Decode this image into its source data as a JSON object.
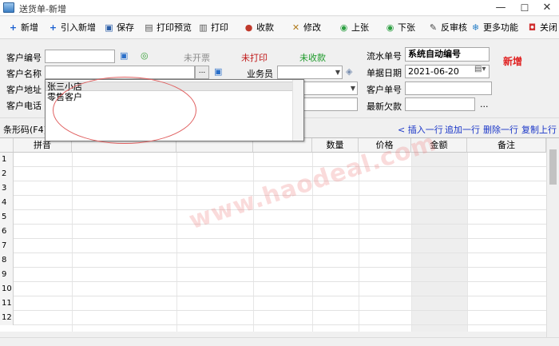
{
  "window": {
    "title": "送货单-新增",
    "min": "—",
    "max": "☐",
    "close": "✕"
  },
  "toolbar": [
    {
      "label": "新增",
      "icon": "+",
      "color": "#1a5fd0"
    },
    {
      "label": "引入新增",
      "icon": "+",
      "color": "#1a5fd0"
    },
    {
      "label": "保存",
      "icon": "▣",
      "color": "#2b5ea8"
    },
    {
      "label": "打印预览",
      "icon": "▤",
      "color": "#555555"
    },
    {
      "label": "打印",
      "icon": "▥",
      "color": "#555555"
    },
    {
      "label": "收款",
      "icon": "●",
      "color": "#c0392b"
    },
    {
      "label": "修改",
      "icon": "✕",
      "color": "#b07a1a"
    },
    {
      "label": "上张",
      "icon": "◉",
      "color": "#2ea043"
    },
    {
      "label": "下张",
      "icon": "◉",
      "color": "#2ea043"
    },
    {
      "label": "反审核",
      "icon": "✎",
      "color": "#444444"
    },
    {
      "label": "更多功能",
      "icon": "❄",
      "color": "#2a80c8"
    },
    {
      "label": "关闭",
      "icon": "◘",
      "color": "#d03030"
    }
  ],
  "form": {
    "customer_code_label": "客户编号",
    "customer_name_label": "客户名称",
    "customer_address_label": "客户地址",
    "customer_phone_label": "客户电话",
    "invoice_status": "未开票",
    "print_status": "未打印",
    "payment_status": "未收款",
    "salesman_label": "业务员",
    "serial_label": "流水单号",
    "serial_value": "系统自动编号",
    "date_label": "单据日期",
    "date_value": "2021-06-20",
    "customer_order_label": "客户单号",
    "latest_debt_label": "最新欠款",
    "mode_badge": "新增",
    "browse_button": "...",
    "more_button": "..."
  },
  "barcode": {
    "label": "条形码(F4)",
    "insert_row": "< 插入一行",
    "append_row": "追加一行",
    "delete_row": "删除一行",
    "copy_row": "复制上行"
  },
  "grid": {
    "columns": [
      "",
      "拼音",
      "",
      "",
      "",
      "数量",
      "价格",
      "金额",
      "备注"
    ],
    "rows": [
      "1",
      "2",
      "3",
      "4",
      "5",
      "6",
      "7",
      "8",
      "9",
      "10",
      "11",
      "12"
    ]
  },
  "dropdown": {
    "items": [
      "张三小店",
      "零售客户"
    ]
  },
  "watermark": "www.haodeal.com",
  "colors": {
    "status_invoice": "#8a8a8a",
    "status_print": "#c01818",
    "status_payment": "#1e9a2a",
    "badge": "#e02020",
    "link": "#1a36c8"
  }
}
